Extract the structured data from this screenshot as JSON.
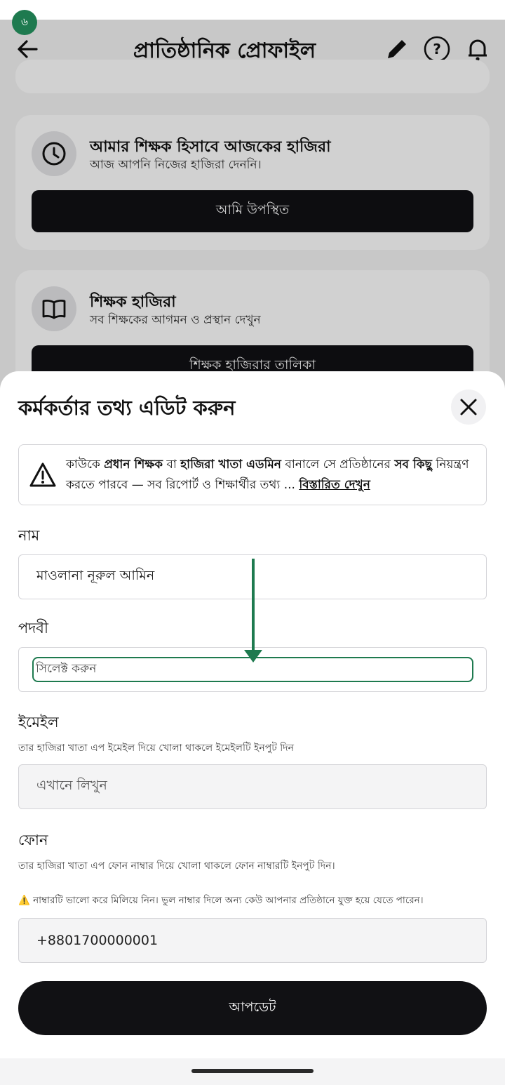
{
  "status": {
    "badge": "৬"
  },
  "appbar": {
    "title": "প্রাতিষ্ঠানিক প্রোফাইল",
    "icons": [
      "back-arrow-icon",
      "edit-icon",
      "help-icon",
      "bell-icon"
    ]
  },
  "cards": [
    {
      "icon": "clock-icon",
      "title": "আমার শিক্ষক হিসাবে আজকের হাজিরা",
      "subtitle": "আজ আপনি নিজের হাজিরা দেননি।",
      "button": "আমি উপস্থিত"
    },
    {
      "icon": "book-icon",
      "title": "শিক্ষক হাজিরা",
      "subtitle": "সব শিক্ষকের আগমন ও প্রস্থান দেখুন",
      "button": "শিক্ষক হাজিরার তালিকা"
    }
  ],
  "sheet": {
    "title": "কর্মকর্তার তথ্য এডিট করুন",
    "warning": {
      "t1": "কাউকে ",
      "b1": "প্রধান শিক্ষক",
      "t2": " বা ",
      "b2": "হাজিরা খাতা এডমিন",
      "t3": " বানালে সে প্রতিষ্ঠানের ",
      "b3": "সব কিছু",
      "t4": " নিয়ন্ত্রণ করতে পারবে — সব রিপোর্ট ও শিক্ষার্থীর তথ্য ... ",
      "link": "বিস্তারিত দেখুন"
    },
    "name_label": "নাম",
    "name_value": "মাওলানা নূরুল আমিন",
    "designation_label": "পদবী",
    "designation_placeholder": "সিলেক্ট করুন",
    "email_label": "ইমেইল",
    "email_hint": "তার হাজিরা খাতা এপ ইমেইল দিয়ে খোলা থাকলে ইমেইলটি ইনপুট দিন",
    "email_placeholder": "এখানে লিখুন",
    "phone_label": "ফোন",
    "phone_hint": "তার হাজিরা খাতা এপ ফোন নাম্বার দিয়ে খোলা থাকলে ফোন নাম্বারটি ইনপুট দিন।",
    "phone_warning": "⚠️ নাম্বারটি ভালো করে মিলিয়ে নিন। ভুল নাম্বার দিলে অন্য কেউ আপনার প্রতিষ্ঠানে যুক্ত হয়ে যেতে পারেন।",
    "phone_value": "+8801700000001",
    "update_button": "আপডেট"
  },
  "colors": {
    "accent": "#1e7a4f",
    "button_dark": "#111114"
  }
}
